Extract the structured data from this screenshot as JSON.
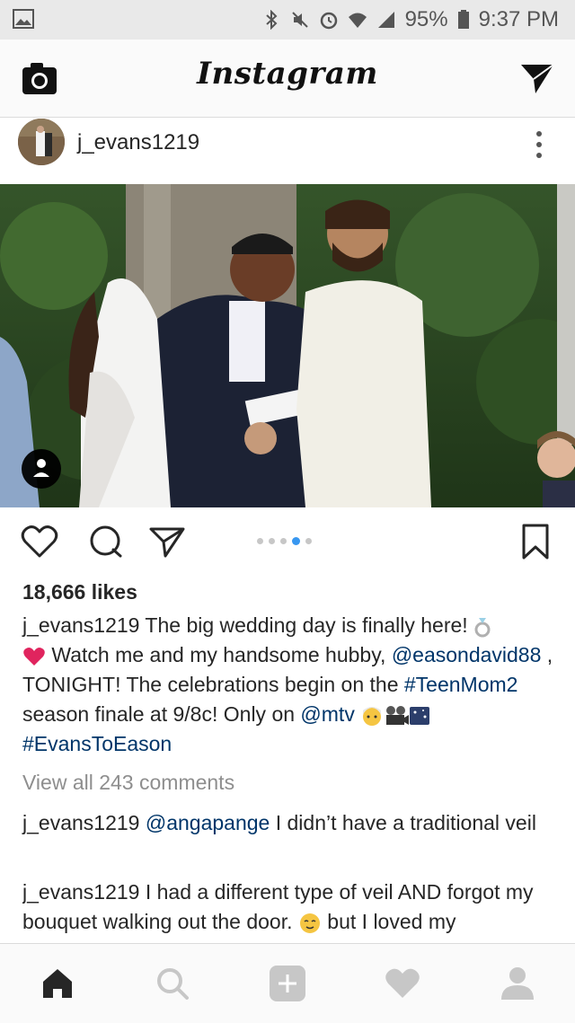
{
  "status_bar": {
    "battery": "95%",
    "time": "9:37 PM",
    "icons": [
      "bluetooth-icon",
      "mute-icon",
      "alarm-icon",
      "wifi-icon",
      "signal-icon",
      "battery-icon"
    ]
  },
  "header": {
    "logo": "Instagram",
    "icons": [
      "camera-icon",
      "direct-message-icon"
    ]
  },
  "post": {
    "username": "j_evans1219",
    "likes": "18,666 likes",
    "carousel": {
      "count": 5,
      "active_index": 3
    },
    "caption": {
      "username": "j_evans1219",
      "text_1": " The big wedding day is finally here! ",
      "text_2": " Watch me and my handsome hubby, ",
      "mention": "@easondavid88",
      "text_3": " , TONIGHT! The celebrations begin on the ",
      "hashtag_1": "#TeenMom2",
      "text_4": " season finale at 9/8c! Only on ",
      "mention_2": "@mtv",
      "hashtag_2": "#EvansToEason"
    },
    "view_all": "View all 243 comments",
    "comments": [
      {
        "username": "j_evans1219",
        "mention": "@angapange",
        "text": " I didn’t have a traditional veil"
      },
      {
        "username": "j_evans1219",
        "text": " I had a different type of veil AND forgot my bouquet walking out the door. ",
        "text_2": " but I loved my"
      }
    ]
  },
  "colors": {
    "link": "#003569",
    "carousel_active": "#3897f0",
    "muted": "#8e8e8e"
  },
  "bottom_nav": [
    "home-icon",
    "search-icon",
    "add-post-icon",
    "activity-heart-icon",
    "profile-icon"
  ]
}
